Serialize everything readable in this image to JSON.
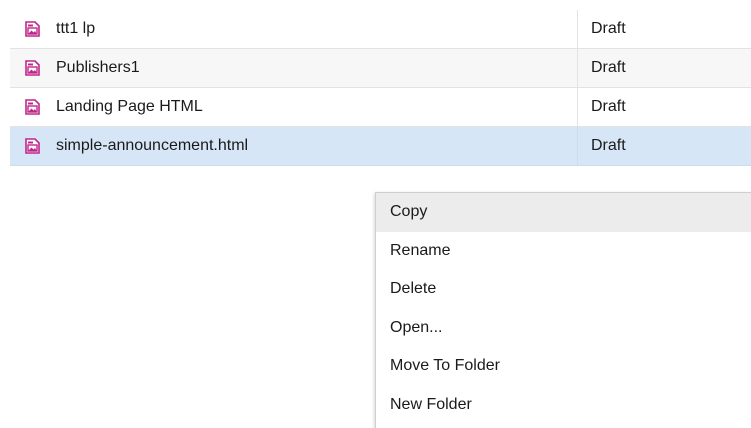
{
  "icons": {
    "file": "landing-page-file-icon",
    "file_color": "#c0268a"
  },
  "files": [
    {
      "name": "ttt1 lp",
      "status": "Draft"
    },
    {
      "name": "Publishers1",
      "status": "Draft"
    },
    {
      "name": "Landing Page HTML",
      "status": "Draft"
    },
    {
      "name": "simple-announcement.html",
      "status": "Draft"
    }
  ],
  "selected_index": 3,
  "context_menu": {
    "items": [
      {
        "label": "Copy"
      },
      {
        "label": "Rename"
      },
      {
        "label": "Delete"
      },
      {
        "label": "Open..."
      },
      {
        "label": "Move To Folder"
      },
      {
        "label": "New Folder"
      }
    ],
    "hover_index": 0
  },
  "colors": {
    "selected_row": "#d6e6f7",
    "hover_item": "#ececec"
  }
}
